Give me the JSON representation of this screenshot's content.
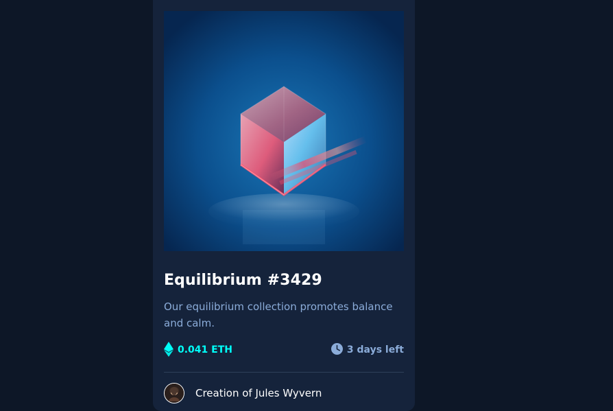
{
  "card": {
    "image_alt": "Equilibrium",
    "title": "Equilibrium #3429",
    "description": "Our equilibrium collection promotes balance and calm.",
    "price": "0.041 ETH",
    "time_left": "3 days left",
    "creator_text": "Creation of Jules Wyvern"
  },
  "icons": {
    "price": "ethereum-icon",
    "time": "clock-icon",
    "avatar": "creator-avatar"
  },
  "colors": {
    "background": "#0d1727",
    "card": "#15233b",
    "accent": "#00fff8",
    "muted": "#8bacd9",
    "text": "#ffffff"
  }
}
